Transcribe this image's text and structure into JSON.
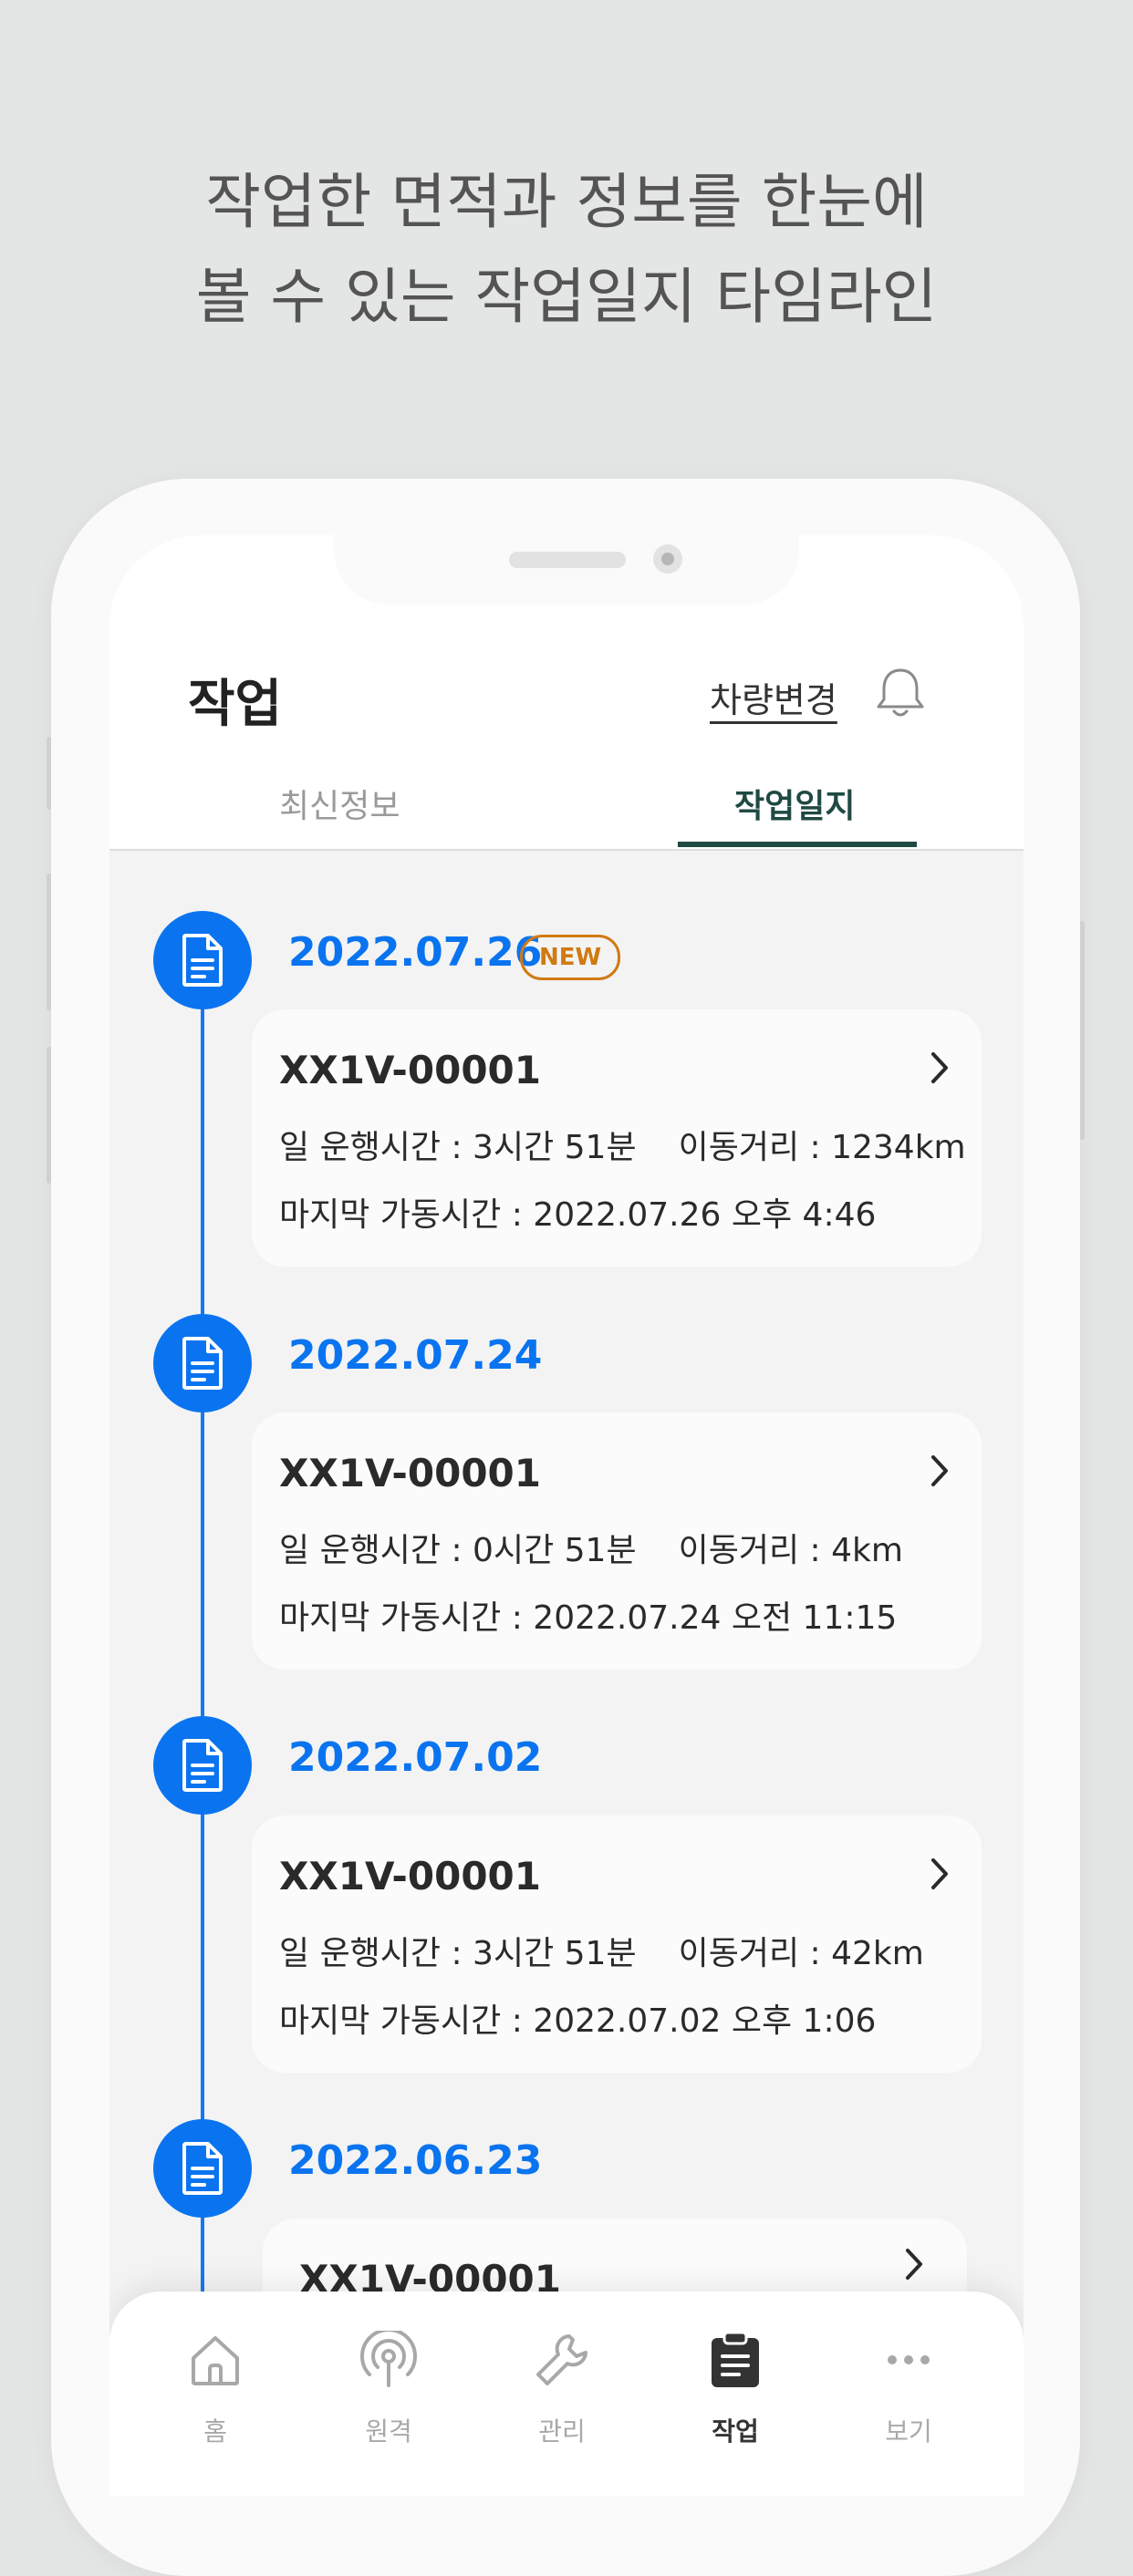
{
  "headline": {
    "line1": "작업한 면적과 정보를 한눈에",
    "line2": "볼 수 있는 작업일지 타임라인"
  },
  "header": {
    "title": "작업",
    "change_vehicle": "차량변경",
    "icon": "bell-icon"
  },
  "tabs": [
    {
      "label": "최신정보",
      "active": false
    },
    {
      "label": "작업일지",
      "active": true
    }
  ],
  "accent_color": "#0a74f0",
  "badge_new": "NEW",
  "entries": [
    {
      "date": "2022.07.26",
      "new": true,
      "vehicle": "XX1V-00001",
      "operating_time": "일 운행시간 : 3시간 51분",
      "distance": "이동거리 : 1234km",
      "last_operation": "마지막 가동시간 : 2022.07.26 오후 4:46"
    },
    {
      "date": "2022.07.24",
      "new": false,
      "vehicle": "XX1V-00001",
      "operating_time": "일 운행시간 : 0시간 51분",
      "distance": "이동거리 : 4km",
      "last_operation": "마지막 가동시간 : 2022.07.24 오전 11:15"
    },
    {
      "date": "2022.07.02",
      "new": false,
      "vehicle": "XX1V-00001",
      "operating_time": "일 운행시간 : 3시간 51분",
      "distance": "이동거리 : 42km",
      "last_operation": "마지막 가동시간 : 2022.07.02 오후 1:06"
    },
    {
      "date": "2022.06.23",
      "new": false,
      "vehicle": "XX1V-00001"
    }
  ],
  "nav": [
    {
      "label": "홈",
      "icon": "home-icon",
      "active": false
    },
    {
      "label": "원격",
      "icon": "remote-signal-icon",
      "active": false
    },
    {
      "label": "관리",
      "icon": "wrench-icon",
      "active": false
    },
    {
      "label": "작업",
      "icon": "clipboard-icon",
      "active": true
    },
    {
      "label": "보기",
      "icon": "more-icon",
      "active": false
    }
  ]
}
